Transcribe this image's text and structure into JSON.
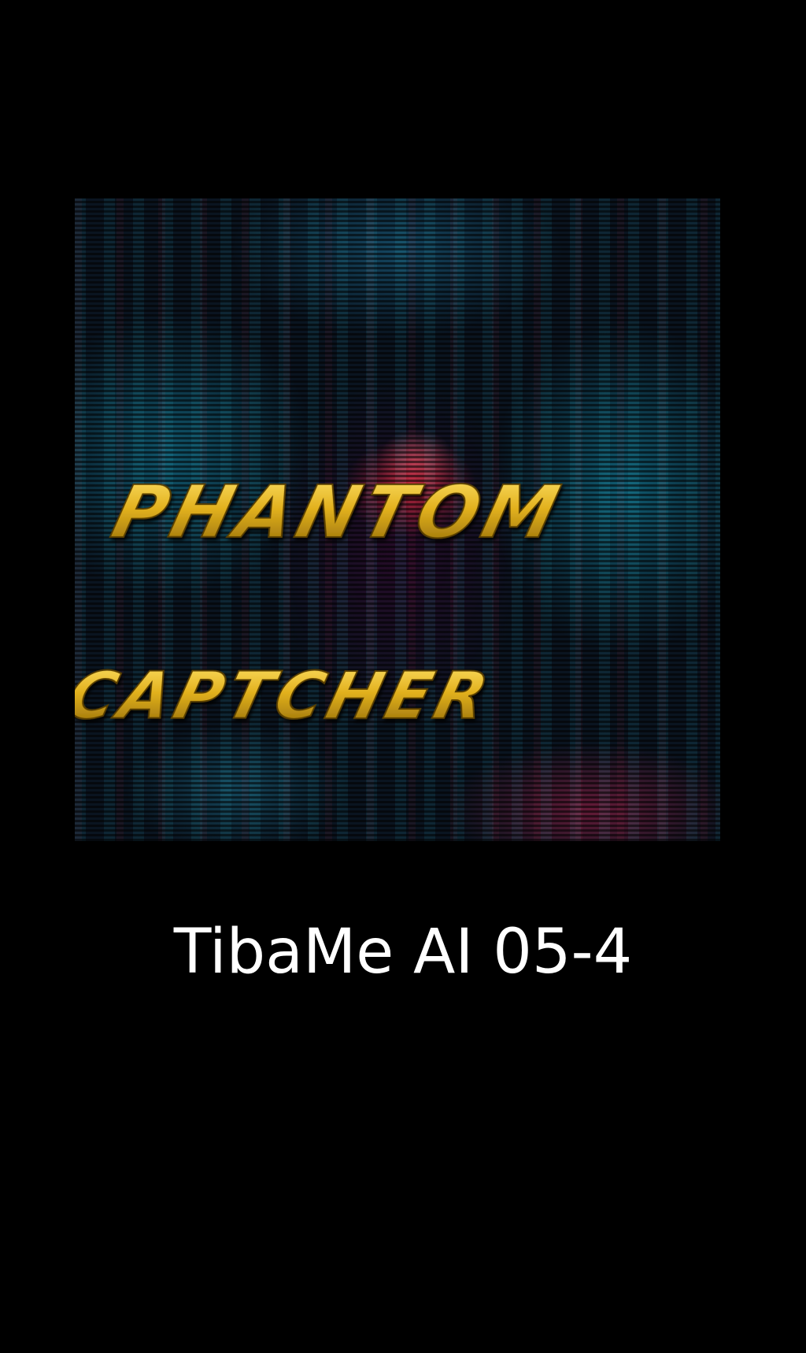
{
  "poster": {
    "logo_line_1": "PHANTOM",
    "logo_line_2": "CAPTCHER",
    "logo_color": "#E2B11E",
    "background_colors": [
      "#0A1420",
      "#22A6C0",
      "#C8283C"
    ]
  },
  "caption": {
    "text": "TibaMe AI 05-4",
    "color": "#FFFFFF"
  }
}
